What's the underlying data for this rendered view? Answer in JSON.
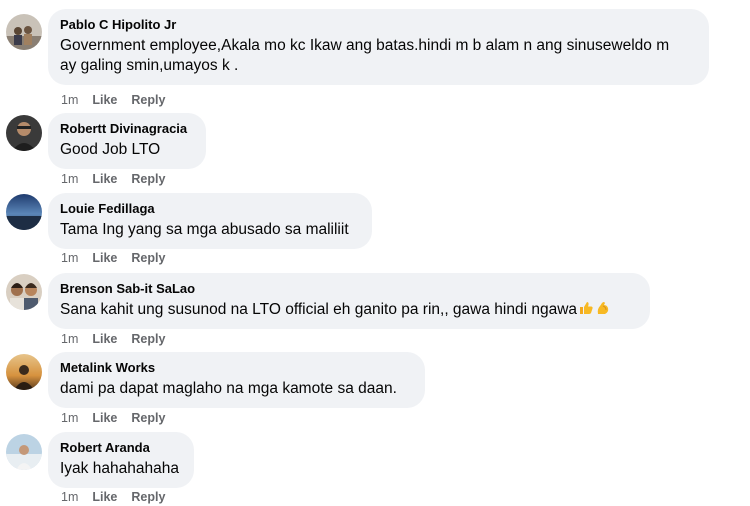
{
  "comments": [
    {
      "author": "Pablo C Hipolito Jr",
      "text": "Government employee,Akala mo kc Ikaw ang batas.hindi m b alam n ang sinuseweldo m\nay galing smin,umayos k .",
      "time": "1m",
      "like_label": "Like",
      "reply_label": "Reply",
      "avatar_icon": "avatar-icon"
    },
    {
      "author": "Robertt Divinagracia",
      "text": "Good Job LTO",
      "time": "1m",
      "like_label": "Like",
      "reply_label": "Reply",
      "avatar_icon": "avatar-icon"
    },
    {
      "author": "Louie Fedillaga",
      "text": "Tama Ing yang sa mga abusado sa maliliit",
      "time": "1m",
      "like_label": "Like",
      "reply_label": "Reply",
      "avatar_icon": "avatar-icon"
    },
    {
      "author": "Brenson Sab-it SaLao",
      "text": "Sana kahit ung susunod na LTO official eh ganito pa rin,, gawa hindi ngawa",
      "emojis": [
        "thumbs-up-icon",
        "flexed-biceps-icon"
      ],
      "time": "1m",
      "like_label": "Like",
      "reply_label": "Reply",
      "avatar_icon": "avatar-icon"
    },
    {
      "author": "Metalink Works",
      "text": "dami pa dapat maglaho na mga kamote sa daan.",
      "time": "1m",
      "like_label": "Like",
      "reply_label": "Reply",
      "avatar_icon": "avatar-icon"
    },
    {
      "author": "Robert Aranda",
      "text": "Iyak hahahahaha",
      "time": "1m",
      "like_label": "Like",
      "reply_label": "Reply",
      "avatar_icon": "avatar-icon"
    }
  ],
  "colors": {
    "bubble_bg": "#f0f2f5",
    "meta_text": "#65676b",
    "primary_text": "#050505",
    "emoji_yellow": "#f7b924"
  }
}
